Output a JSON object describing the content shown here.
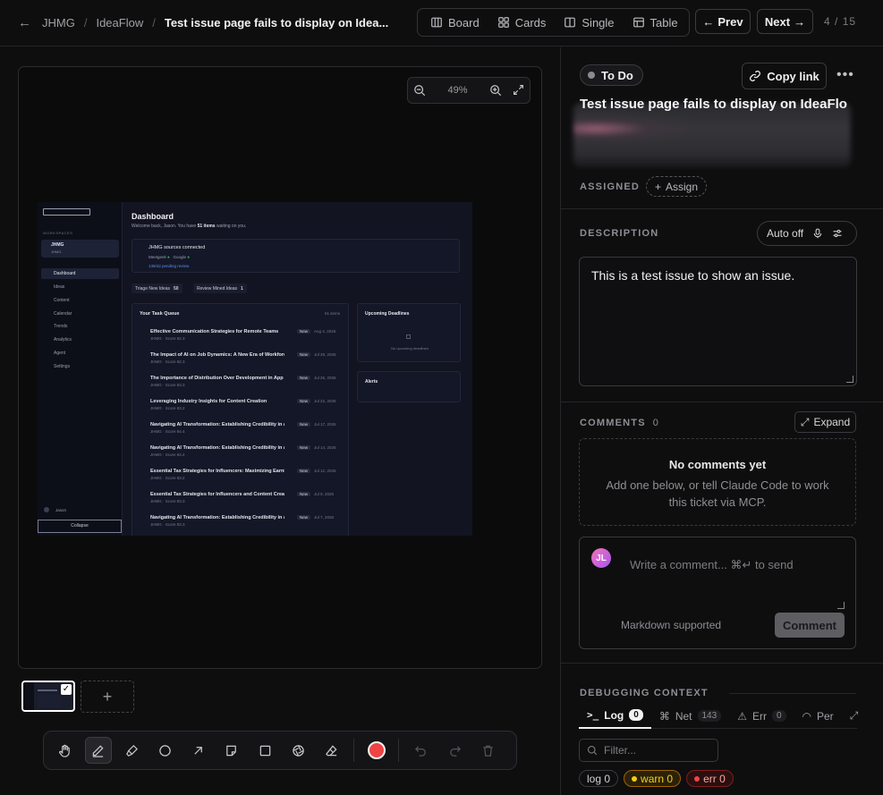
{
  "breadcrumb": {
    "root": "JHMG",
    "project": "IdeaFlow",
    "current": "Test issue page fails to display on Idea..."
  },
  "views": [
    {
      "label": "Board",
      "icon": "board-icon"
    },
    {
      "label": "Cards",
      "icon": "cards-icon"
    },
    {
      "label": "Single",
      "icon": "single-icon"
    },
    {
      "label": "Table",
      "icon": "table-icon"
    }
  ],
  "nav": {
    "prev": "Prev",
    "next": "Next",
    "position": "4",
    "total": "15"
  },
  "zoom": {
    "level": "49%"
  },
  "thumbnails": {
    "add": "+"
  },
  "issue": {
    "status": "To Do",
    "copy_link": "Copy link",
    "title": "Test issue page fails to display on IdeaFlo",
    "assigned_label": "ASSIGNED",
    "assign_button": "Assign",
    "description_label": "DESCRIPTION",
    "auto_label": "Auto off",
    "description": "This is a test issue to show an issue."
  },
  "comments": {
    "label": "COMMENTS",
    "count": "0",
    "expand": "Expand",
    "empty_title": "No comments yet",
    "empty_text": "Add one below, or tell Claude Code to work this ticket via MCP.",
    "avatar": "JL",
    "placeholder": "Write a comment... ⌘↵ to send",
    "markdown": "Markdown supported",
    "submit": "Comment"
  },
  "debug": {
    "label": "DEBUGGING CONTEXT",
    "tabs": [
      {
        "label": "Log",
        "count": "0"
      },
      {
        "label": "Net",
        "count": "143"
      },
      {
        "label": "Err",
        "count": "0"
      },
      {
        "label": "Per",
        "count": ""
      }
    ],
    "filter_placeholder": "Filter...",
    "pills": {
      "log": "log 0",
      "warn": "warn 0",
      "err": "err 0"
    }
  },
  "screenshot": {
    "workspaces": "WORKSPACES",
    "org": "JHMG",
    "org_sub": "JHMG",
    "sidebar": [
      "Dashboard",
      "Ideas",
      "Content",
      "Calendar",
      "Trends",
      "Analytics",
      "Agent",
      "Settings"
    ],
    "user": "Jason",
    "collapse": "Collapse",
    "title": "Dashboard",
    "subtitle_pre": "Welcome back, Jason. You have ",
    "subtitle_count": "51 items",
    "subtitle_post": " waiting on you.",
    "sources_title": "JHMG sources connected",
    "source1": "Meetgeek",
    "source2": "Google",
    "pending": "136/42 pending review",
    "triage": "Triage New Ideas",
    "triage_count": "50",
    "review": "Review Mined Ideas",
    "review_count": "1",
    "queue_title": "Your Task Queue",
    "queue_count": "51 items",
    "deadlines_title": "Upcoming Deadlines",
    "no_deadlines": "No upcoming deadlines",
    "alerts_title": "Alerts",
    "tasks": [
      {
        "title": "Effective Communication Strategies for Remote Teams",
        "sub": "JHMG · Score 82.3",
        "badge": "New",
        "date": "Aug 4, 2026"
      },
      {
        "title": "The Impact of AI on Job Dynamics: A New Era of Workforce ...",
        "sub": "JHMG · Score 82.3",
        "badge": "New",
        "date": "Jul 29, 2026"
      },
      {
        "title": "The Importance of Distribution Over Development in App Cr...",
        "sub": "JHMG · Score 83.3",
        "badge": "New",
        "date": "Jul 26, 2026"
      },
      {
        "title": "Leveraging Industry Insights for Content Creation",
        "sub": "JHMG · Score 83.2",
        "badge": "New",
        "date": "Jul 22, 2026"
      },
      {
        "title": "Navigating AI Transformation: Establishing Credibility in a Sk...",
        "sub": "JHMG · Score 84.4",
        "badge": "New",
        "date": "Jul 17, 2026"
      },
      {
        "title": "Navigating AI Transformation: Establishing Credibility in a Sk...",
        "sub": "JHMG · Score 84.4",
        "badge": "New",
        "date": "Jul 14, 2026"
      },
      {
        "title": "Essential Tax Strategies for Influencers: Maximizing Earnings ...",
        "sub": "JHMG · Score 83.2",
        "badge": "New",
        "date": "Jul 12, 2026"
      },
      {
        "title": "Essential Tax Strategies for Influencers and Content Creators",
        "sub": "JHMG · Score 83.3",
        "badge": "New",
        "date": "Jul 9, 2026"
      },
      {
        "title": "Navigating AI Transformation: Establishing Credibility in a Ske...",
        "sub": "JHMG · Score 83.3",
        "badge": "New",
        "date": "Jul 7, 2026"
      }
    ]
  },
  "colors": {
    "accent_red": "#ef4444",
    "warn": "#facc15",
    "avatar": "#f472b6"
  }
}
